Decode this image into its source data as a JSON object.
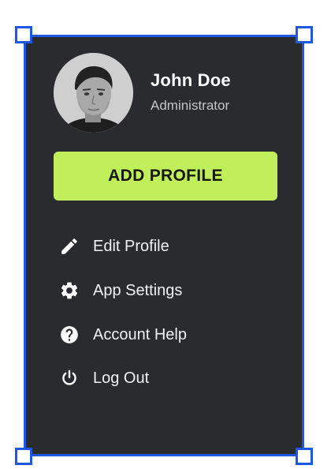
{
  "profile": {
    "name": "John Doe",
    "role": "Administrator"
  },
  "add_button": {
    "label": "ADD PROFILE"
  },
  "menu": {
    "items": [
      {
        "label": "Edit Profile",
        "icon": "pencil-icon"
      },
      {
        "label": "App Settings",
        "icon": "gear-icon"
      },
      {
        "label": "Account Help",
        "icon": "question-circle-icon"
      },
      {
        "label": "Log Out",
        "icon": "power-icon"
      }
    ]
  },
  "colors": {
    "panel_background": "#2a2b2f",
    "selection_border": "#1f58e0",
    "accent": "#c1ef5c",
    "text_primary": "#ffffff",
    "text_secondary": "#c4c5c9"
  }
}
